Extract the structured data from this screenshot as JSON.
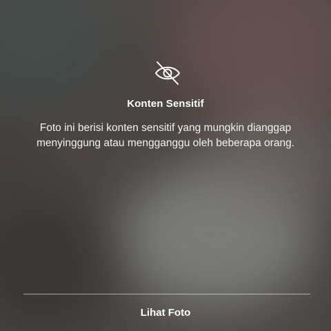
{
  "overlay": {
    "icon": "eye-slash-icon",
    "title": "Konten Sensitif",
    "message": "Foto ini berisi konten sensitif yang mungkin dianggap menyinggung atau mengganggu oleh beberapa orang.",
    "action_label": "Lihat Foto"
  }
}
